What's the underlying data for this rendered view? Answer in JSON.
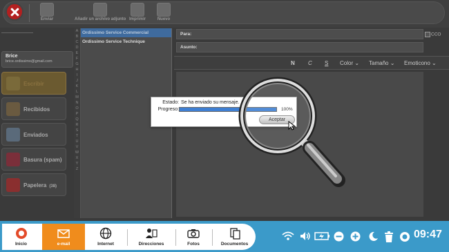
{
  "toolbar": {
    "send_label": "Enviar",
    "attach_label": "Añadir un archivo adjunto",
    "print_label": "Imprimir",
    "new_label": "Nuevo"
  },
  "user": {
    "name": "Brice",
    "email": "brice.ordissimo@gmail.com"
  },
  "folders": [
    {
      "label": "Escribir",
      "count": ""
    },
    {
      "label": "Recibidos",
      "count": ""
    },
    {
      "label": "Enviados",
      "count": ""
    },
    {
      "label": "Basura (spam)",
      "count": ""
    },
    {
      "label": "Papelera",
      "count": "(38)"
    }
  ],
  "alphabet": "ABCDEFGHIJKLMNOPQRSTUVWXYZ",
  "contacts": [
    "Ordissimo Service Commercial",
    "Ordissimo Service Technique"
  ],
  "compose": {
    "to_label": "Para:",
    "subject_label": "Asunto:",
    "cco_label": "CCO",
    "bold": "N",
    "italic": "C",
    "underline": "S",
    "color": "Color",
    "size": "Tamaño",
    "emoticon": "Emoticono"
  },
  "dialog": {
    "status_label": "Estado:",
    "status_value": "Se ha enviado su mensaje.",
    "progress_label": "Progreso:",
    "progress_value": 100,
    "progress_text": "100%",
    "accept_label": "Aceptar"
  },
  "dock": {
    "items": [
      {
        "label": "Inicio"
      },
      {
        "label": "e-mail"
      },
      {
        "label": "Internet"
      },
      {
        "label": "Direcciones"
      },
      {
        "label": "Fotos"
      },
      {
        "label": "Documentos"
      }
    ]
  },
  "clock": "09:47",
  "colors": {
    "accent": "#f08c1c",
    "taskbar": "#3b9ac9",
    "progress": "#3f7fd2"
  }
}
